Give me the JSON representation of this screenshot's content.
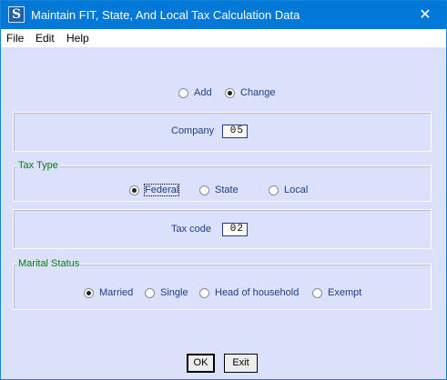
{
  "window": {
    "title": "Maintain FIT, State, And Local Tax Calculation Data",
    "close_glyph": "✕",
    "app_icon_letter": "S"
  },
  "menu": [
    "File",
    "Edit",
    "Help"
  ],
  "mode": {
    "options": [
      {
        "label": "Add",
        "checked": false
      },
      {
        "label": "Change",
        "checked": true
      }
    ]
  },
  "company": {
    "label": "Company",
    "value": "05"
  },
  "tax_type": {
    "title": "Tax Type",
    "options": [
      {
        "label": "Federal",
        "checked": true
      },
      {
        "label": "State",
        "checked": false
      },
      {
        "label": "Local",
        "checked": false
      }
    ]
  },
  "tax_code": {
    "label": "Tax code",
    "value": "02"
  },
  "marital_status": {
    "title": "Marital Status",
    "options": [
      {
        "label": "Married",
        "checked": true
      },
      {
        "label": "Single",
        "checked": false
      },
      {
        "label": "Head of household",
        "checked": false
      },
      {
        "label": "Exempt",
        "checked": false
      }
    ]
  },
  "buttons": {
    "ok": "OK",
    "exit": "Exit"
  }
}
